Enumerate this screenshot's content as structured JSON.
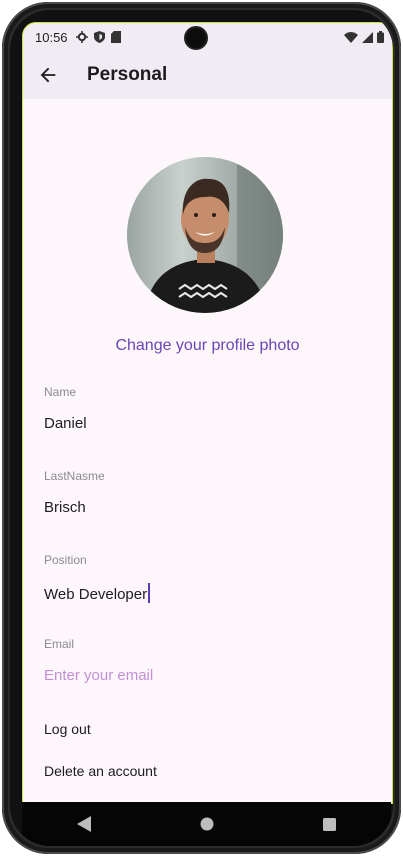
{
  "status_bar": {
    "time": "10:56"
  },
  "app_bar": {
    "title": "Personal"
  },
  "profile": {
    "change_photo_label": "Change your profile photo"
  },
  "fields": [
    {
      "label": "Name",
      "value": "Daniel"
    },
    {
      "label": "LastNasme",
      "value": "Brisch"
    },
    {
      "label": "Position",
      "value": "Web Developer"
    },
    {
      "label": "Email",
      "placeholder": "Enter your email"
    }
  ],
  "actions": {
    "logout": "Log out",
    "delete_account": "Delete an account"
  },
  "colors": {
    "accent": "#6a45b3",
    "placeholder": "#c28fd6",
    "surface": "#fdf7fc",
    "bar": "#f1ecf4"
  },
  "icons": [
    "settings-icon",
    "shield-icon",
    "sd-card-icon",
    "wifi-icon",
    "signal-icon",
    "battery-icon",
    "arrow-back-icon",
    "nav-back-icon",
    "nav-home-icon",
    "nav-recents-icon"
  ]
}
